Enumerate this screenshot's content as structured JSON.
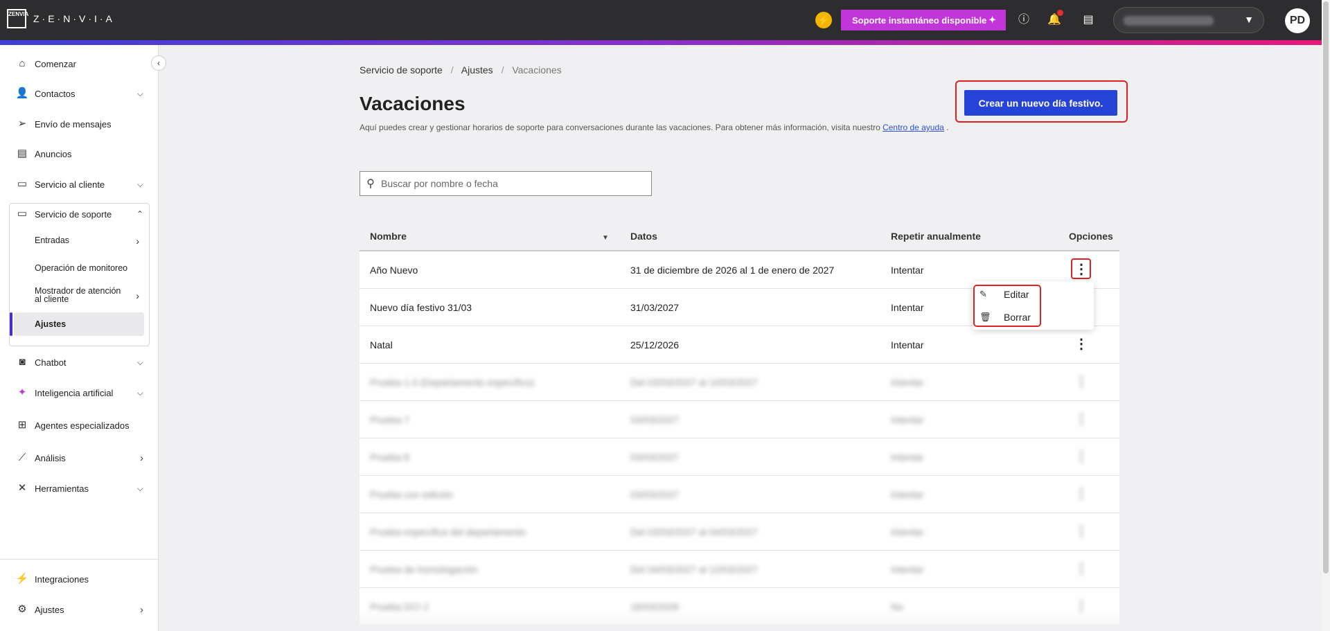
{
  "topbar": {
    "logo_box": [
      "ZEN",
      "VIA"
    ],
    "logo_text": "Z·E·N·V·I·A",
    "support_label": "Soporte instantáneo disponible",
    "avatar_initials": "PD"
  },
  "sidebar": {
    "items": [
      {
        "label": "Comenzar"
      },
      {
        "label": "Contactos"
      },
      {
        "label": "Envío de mensajes"
      },
      {
        "label": "Anuncios"
      },
      {
        "label": "Servicio al cliente"
      },
      {
        "label": "Servicio de soporte"
      },
      {
        "label": "Chatbot"
      },
      {
        "label": "Inteligencia artificial"
      },
      {
        "label": "Agentes especializados"
      },
      {
        "label": "Análisis"
      },
      {
        "label": "Herramientas"
      },
      {
        "label": "Integraciones"
      },
      {
        "label": "Ajustes"
      }
    ],
    "sub_items": [
      {
        "label": "Entradas"
      },
      {
        "label": "Operación de monitoreo"
      },
      {
        "label": "Mostrador de atención al cliente"
      },
      {
        "label": "Ajustes",
        "active": true
      }
    ]
  },
  "breadcrumb": [
    "Servicio de soporte",
    "Ajustes",
    "Vacaciones"
  ],
  "page": {
    "title": "Vacaciones",
    "description": "Aquí puedes crear y gestionar horarios de soporte para conversaciones durante las vacaciones. Para obtener más información, visita nuestro",
    "help_link": "Centro de ayuda",
    "description_end": ".",
    "create_button": "Crear un nuevo día festivo."
  },
  "search": {
    "placeholder": "Buscar por nombre o fecha"
  },
  "table": {
    "headers": [
      "Nombre",
      "Datos",
      "Repetir anualmente",
      "Opciones"
    ],
    "rows": [
      {
        "name": "Año Nuevo",
        "dates": "31 de diciembre de 2026 al 1 de enero de 2027",
        "repeat": "Intentar"
      },
      {
        "name": "Nuevo día festivo 31/03",
        "dates": "31/03/2027",
        "repeat": "Intentar"
      },
      {
        "name": "Natal",
        "dates": "25/12/2026",
        "repeat": "Intentar"
      },
      {
        "name": "Prueba 1.0 (Departamento específico)",
        "dates": "Del 03/03/2027 al 10/03/2027",
        "repeat": "Intentar"
      },
      {
        "name": "Prueba 7",
        "dates": "03/03/2027",
        "repeat": "Intentar"
      },
      {
        "name": "Prueba 8",
        "dates": "03/03/2027",
        "repeat": "Intentar"
      },
      {
        "name": "Prueba con edición",
        "dates": "03/03/2027",
        "repeat": "Intentar"
      },
      {
        "name": "Prueba específica del departamento",
        "dates": "Del 03/03/2027 al 04/03/2027",
        "repeat": "Intentar"
      },
      {
        "name": "Prueba de homologación",
        "dates": "Del 04/03/2027 al 12/03/2027",
        "repeat": "Intentar"
      },
      {
        "name": "Prueba DCI 2",
        "dates": "18/03/2026",
        "repeat": "No"
      }
    ]
  },
  "row_menu": {
    "items": [
      {
        "label": "Editar"
      },
      {
        "label": "Borrar"
      }
    ]
  },
  "colors": {
    "accent": "#2543d6",
    "support": "#c235d8",
    "highlight": "#e02020",
    "active_bar": "#4a2fd0"
  }
}
